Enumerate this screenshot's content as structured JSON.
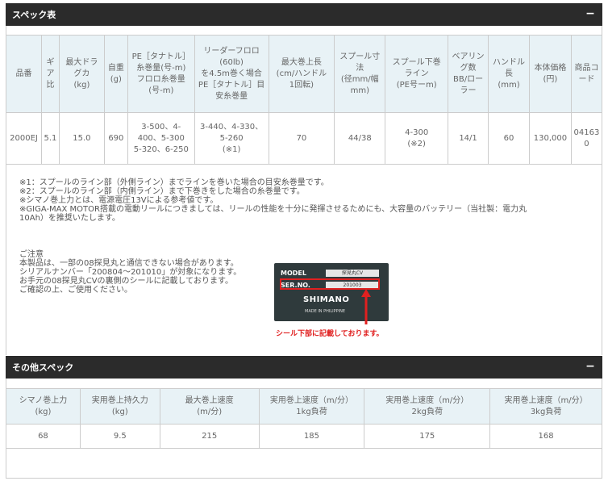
{
  "spec_section": {
    "title": "スペック表",
    "toggle": "−"
  },
  "spec_table": {
    "headers": [
      [
        "品番"
      ],
      [
        "ギ",
        "ア",
        "比"
      ],
      [
        "最大ドラ",
        "グカ",
        "(kg)"
      ],
      [
        "自重",
        "(g)"
      ],
      [
        "PE［タナトル］",
        "糸巻量(号-m)",
        "フロロ糸巻量",
        "(号-m)"
      ],
      [
        "リーダーフロロ",
        "(60lb)",
        "を4.5m巻く場合",
        "PE［タナトル］目",
        "安糸巻量"
      ],
      [
        "最大巻上長",
        "(cm/ハンドル",
        "1回転)"
      ],
      [
        "スプール寸",
        "法",
        "(径mm/幅",
        "mm)"
      ],
      [
        "スプール下巻",
        "ライン",
        "(PE号ーm)"
      ],
      [
        "ベアリン",
        "グ数",
        "BB/ロー",
        "ラー"
      ],
      [
        "ハンドル",
        "長",
        "(mm)"
      ],
      [
        "本体価格",
        "(円)"
      ],
      [
        "商品コ",
        "ード"
      ]
    ],
    "row": [
      [
        "2000EJ"
      ],
      [
        "5.1"
      ],
      [
        "15.0"
      ],
      [
        "690"
      ],
      [
        "3-500、4-",
        "400、5-300",
        "5-320、6-250"
      ],
      [
        "3-440、4-330、",
        "5-260",
        "(※1)"
      ],
      [
        "70"
      ],
      [
        "44/38"
      ],
      [
        "4-300",
        "(※2)"
      ],
      [
        "14/1"
      ],
      [
        "60"
      ],
      [
        "130,000"
      ],
      [
        "04163",
        "0"
      ]
    ]
  },
  "notes": [
    "※1：スプールのライン部（外側ライン）までラインを巻いた場合の目安糸巻量です。",
    "※2：スプールのライン部（内側ライン）まで下巻きをした場合の糸巻量です。",
    "※シマノ巻上力とは、電源電圧13Vによる参考値です。",
    "※GIGA-MAX MOTOR搭載の電動リールにつきましては、リールの性能を十分に発揮させるためにも、大容量のバッテリー（当社製：電力丸",
    "10Ah）を推奨いたします。"
  ],
  "caution": [
    "ご注意",
    "本製品は、一部の08探見丸と通信できない場合があります。",
    "シリアルナンバー「200804～201010」が対象になります。",
    "お手元の08探見丸CVの裏側のシールに記載しております。",
    "ご確認の上、ご使用ください。"
  ],
  "sticker": {
    "model_label": "MODEL",
    "model_value": "探見丸CV",
    "ser_label": "SER.NO.",
    "ser_value": "201003",
    "brand": "SHIMANO",
    "made": "MADE IN PHILIPPINE",
    "caption": "シール下部に記載しております。"
  },
  "other_section": {
    "title": "その他スペック",
    "toggle": "−"
  },
  "other_table": {
    "headers": [
      [
        "シマノ巻上力",
        "(kg)"
      ],
      [
        "実用巻上持久力",
        "(kg)"
      ],
      [
        "最大巻上速度",
        "(m/分)"
      ],
      [
        "実用巻上速度（m/分）",
        "1kg負荷"
      ],
      [
        "実用巻上速度（m/分）",
        "2kg負荷"
      ],
      [
        "実用巻上速度（m/分）",
        "3kg負荷"
      ]
    ],
    "row": [
      "68",
      "9.5",
      "215",
      "185",
      "175",
      "168"
    ]
  },
  "colors": {
    "header_bg": "#2b2b2b",
    "table_header_bg": "#e8f2f6",
    "accent_red": "#e02020"
  }
}
